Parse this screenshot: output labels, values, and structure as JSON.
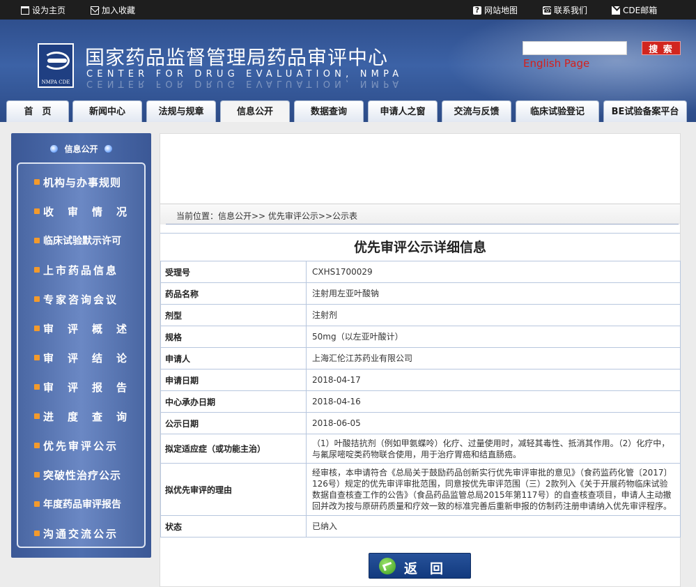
{
  "topbar": {
    "set_home": "设为主页",
    "favorite": "加入收藏",
    "sitemap": "网站地图",
    "contact": "联系我们",
    "mail": "CDE邮箱"
  },
  "header": {
    "title": "国家药品监督管理局药品审评中心",
    "subtitle_en": "CENTER FOR DRUG EVALUATION, NMPA",
    "logo_caption": "NMPA CDE",
    "search_value": "",
    "search_button": "搜 索",
    "english_link": "English Page"
  },
  "nav": {
    "tabs": [
      "首　页",
      "新闻中心",
      "法规与规章",
      "信息公开",
      "数据查询",
      "申请人之窗",
      "交流与反馈",
      "临床试验登记",
      "BE试验备案平台"
    ],
    "active": "信息公开"
  },
  "sidebar": {
    "title": "信息公开",
    "items": [
      "机构与办事规则",
      "收审情况",
      "临床试验默示许可",
      "上市药品信息",
      "专家咨询会议",
      "审评概述",
      "审评结论",
      "审评报告",
      "进度查询",
      "优先审评公示",
      "突破性治疗公示",
      "年度药品审评报告",
      "沟通交流公示"
    ]
  },
  "breadcrumb": "当前位置：信息公开>> 优先审评公示>>公示表",
  "detail": {
    "title": "优先审评公示详细信息",
    "rows": [
      {
        "label": "受理号",
        "value": "CXHS1700029"
      },
      {
        "label": "药品名称",
        "value": "注射用左亚叶酸钠"
      },
      {
        "label": "剂型",
        "value": "注射剂"
      },
      {
        "label": "规格",
        "value": "50mg（以左亚叶酸计）"
      },
      {
        "label": "申请人",
        "value": "上海汇伦江苏药业有限公司"
      },
      {
        "label": "申请日期",
        "value": "2018-04-17"
      },
      {
        "label": "中心承办日期",
        "value": "2018-04-16"
      },
      {
        "label": "公示日期",
        "value": "2018-06-05"
      },
      {
        "label": "拟定适应症（或功能主治）",
        "value": "（1）叶酸拮抗剂（例如甲氨蝶呤）化疗、过量使用时，减轻其毒性、抵消其作用。（2）化疗中，与氟尿嘧啶类药物联合使用，用于治疗胃癌和结直肠癌。"
      },
      {
        "label": "拟优先审评的理由",
        "value": "经审核，本申请符合《总局关于鼓励药品创新实行优先审评审批的意见》（食药监药化管〔2017〕126号）规定的优先审评审批范围，同意按优先审评范围（三）2款列入《关于开展药物临床试验数据自查核查工作的公告》（食品药品监管总局2015年第117号）的自查核查项目，申请人主动撤回并改为按与原研药质量和疗效一致的标准完善后重新申报的仿制药注册申请纳入优先审评程序。"
      },
      {
        "label": "状态",
        "value": "已纳入"
      }
    ]
  },
  "back_button": "返回"
}
